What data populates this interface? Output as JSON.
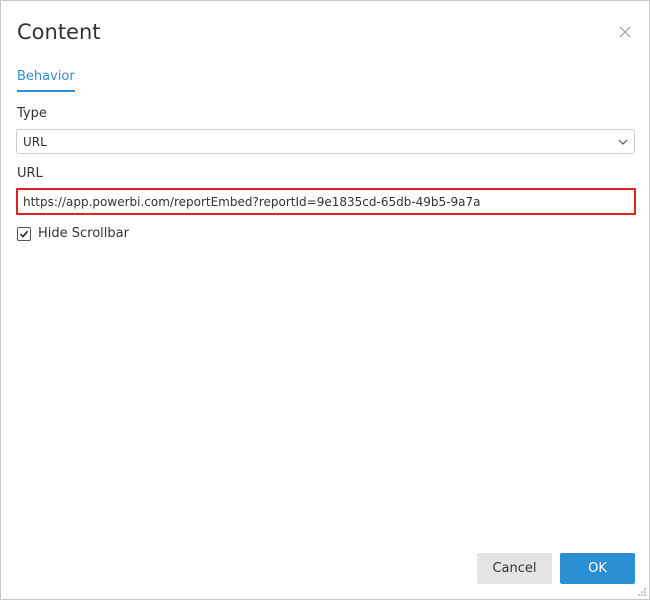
{
  "dialog": {
    "title": "Content"
  },
  "tabs": [
    {
      "label": "Behavior",
      "active": true
    }
  ],
  "form": {
    "type_label": "Type",
    "type_value": "URL",
    "url_label": "URL",
    "url_value": "https://app.powerbi.com/reportEmbed?reportId=9e1835cd-65db-49b5-9a7a",
    "hide_scrollbar_label": "Hide Scrollbar",
    "hide_scrollbar_checked": true
  },
  "buttons": {
    "cancel_label": "Cancel",
    "ok_label": "OK"
  },
  "colors": {
    "accent": "#2b8fd4",
    "highlight": "#e02424"
  },
  "icons": {
    "close": "close-icon",
    "dropdown": "chevron-down-icon",
    "check": "checkmark-icon",
    "resize": "resize-grip-icon"
  }
}
